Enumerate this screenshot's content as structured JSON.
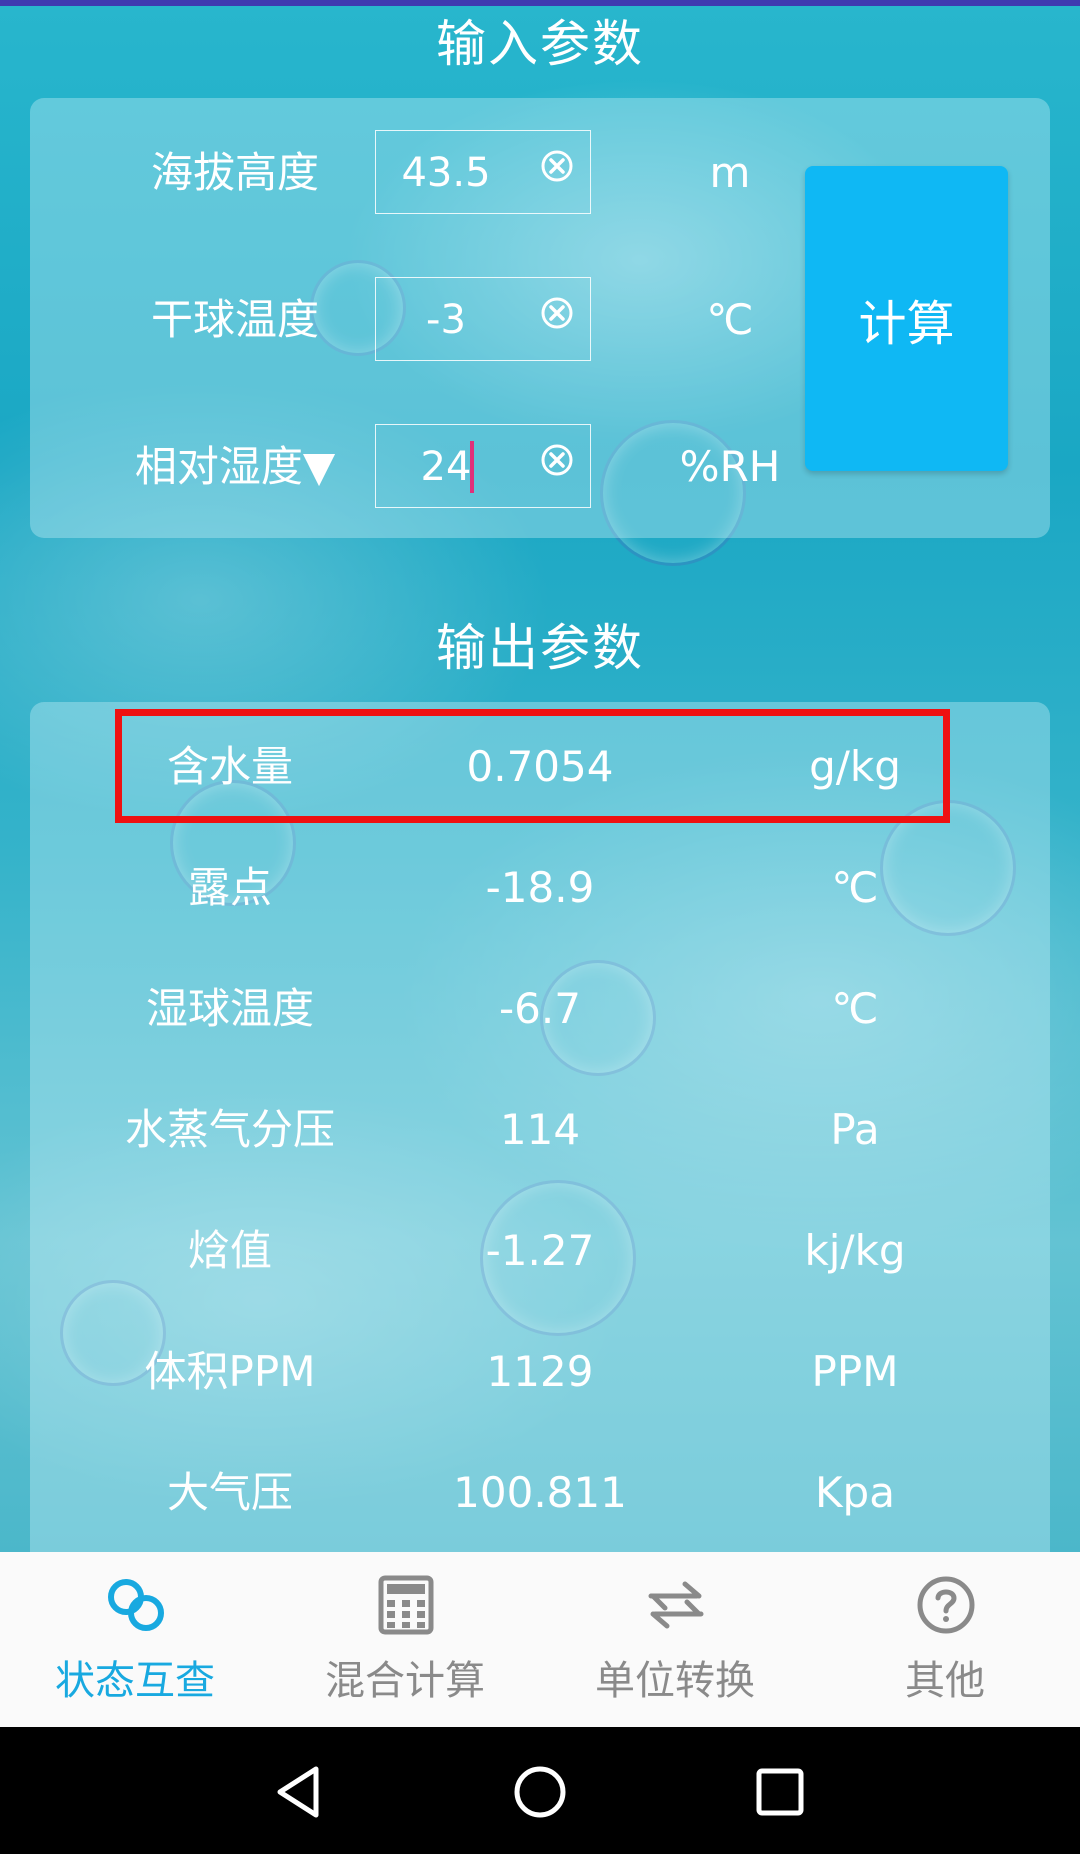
{
  "input": {
    "title": "输入参数",
    "fields": [
      {
        "label": "海拔高度",
        "value": "43.5",
        "unit": "m"
      },
      {
        "label": "干球温度",
        "value": "-3",
        "unit": "℃"
      },
      {
        "label": "相对湿度▼",
        "value": "24",
        "unit": "%RH"
      }
    ],
    "calc_button": "计算"
  },
  "output": {
    "title": "输出参数",
    "rows": [
      {
        "label": "含水量",
        "value": "0.7054",
        "unit": "g/kg"
      },
      {
        "label": "露点",
        "value": "-18.9",
        "unit": "℃"
      },
      {
        "label": "湿球温度",
        "value": "-6.7",
        "unit": "℃"
      },
      {
        "label": "水蒸气分压",
        "value": "114",
        "unit": "Pa"
      },
      {
        "label": "焓值",
        "value": "-1.27",
        "unit": "kj/kg"
      },
      {
        "label": "体积PPM",
        "value": "1129",
        "unit": "PPM"
      },
      {
        "label": "大气压",
        "value": "100.811",
        "unit": "Kpa"
      }
    ]
  },
  "tabs": [
    {
      "label": "状态互查",
      "icon": "link-icon",
      "active": true
    },
    {
      "label": "混合计算",
      "icon": "calculator-icon",
      "active": false
    },
    {
      "label": "单位转换",
      "icon": "swap-icon",
      "active": false
    },
    {
      "label": "其他",
      "icon": "help-icon",
      "active": false
    }
  ],
  "colors": {
    "accent": "#18a9e0",
    "calc_button": "#0fb8f4",
    "highlight": "#ee1111"
  }
}
